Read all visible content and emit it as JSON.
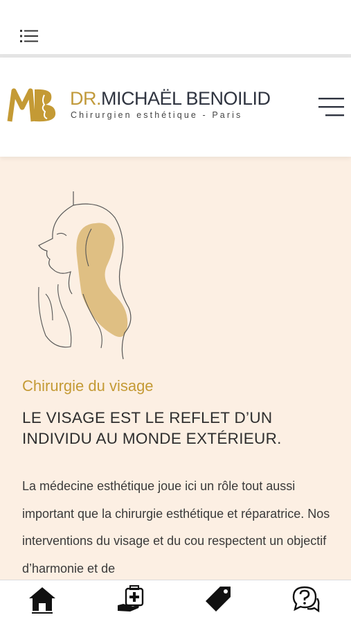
{
  "header": {
    "brand_prefix": "DR.",
    "brand_name": "MICHAËL BENOILID",
    "brand_subtitle": "Chirurgien esthétique - Paris",
    "logo_icon": "mb-monogram-logo",
    "menu_icon": "hamburger-menu-icon"
  },
  "top_bar": {
    "menu_icon": "list-icon"
  },
  "hero": {
    "illustration": "face-line-art-illustration",
    "section_title": "Chirurgie du visage",
    "headline": "LE VISAGE EST LE REFLET D’UN INDIVIDU AU MONDE EXTÉRIEUR.",
    "body": "La médecine esthétique joue ici un rôle tout aussi important que la chirurgie esthétique et réparatrice. Nos interventions du visage et du cou respectent un objectif d’harmonie et de"
  },
  "bottom_nav": {
    "items": [
      {
        "icon": "home-icon"
      },
      {
        "icon": "medical-kit-icon"
      },
      {
        "icon": "price-tag-icon"
      },
      {
        "icon": "question-chat-icon"
      }
    ]
  },
  "colors": {
    "gold": "#c49a35",
    "cream_background": "#fcefe3",
    "dark_text": "#2f3440"
  }
}
